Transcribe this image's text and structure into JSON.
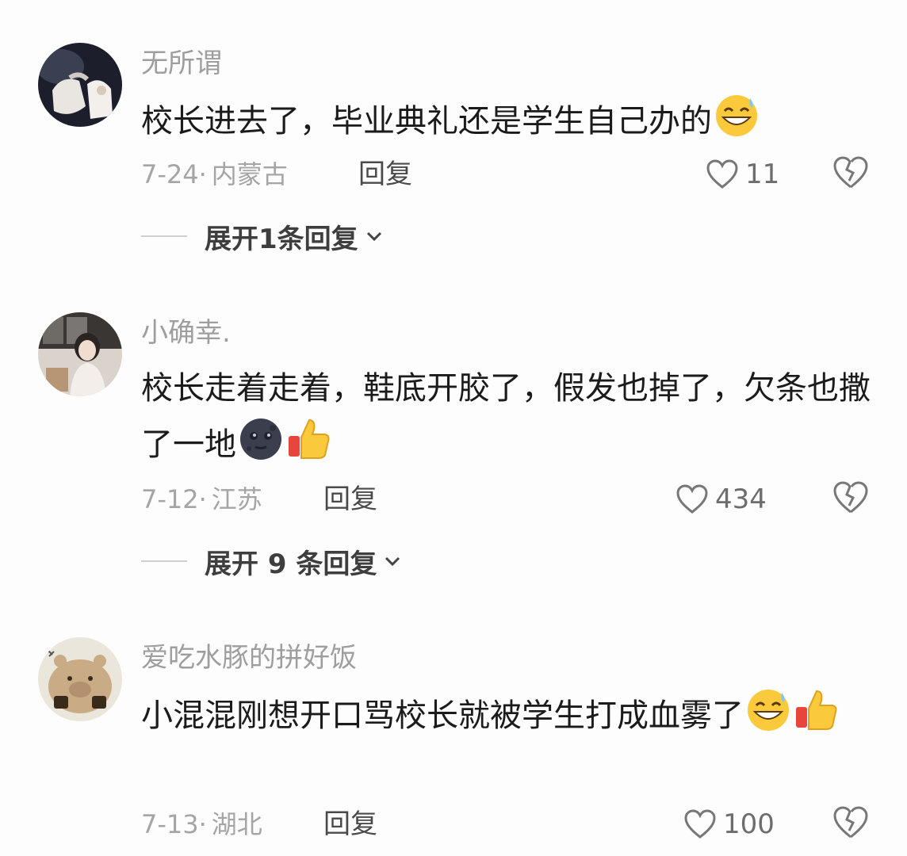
{
  "comments": [
    {
      "username": "无所谓",
      "content": "校长进去了，毕业典礼还是学生自己办的",
      "date": "7-24·",
      "location": "内蒙古",
      "reply_label": "回复",
      "likes": "11",
      "expand_text": "展开1条回复",
      "emoji": [
        "grinning-sweat-emoji"
      ]
    },
    {
      "username": "小确幸.",
      "content": "校长走着走着，鞋底开胶了，假发也掉了，欠条也撒了一地",
      "date": "7-12·",
      "location": "江苏",
      "reply_label": "回复",
      "likes": "434",
      "expand_text": "展开 9 条回复",
      "emoji": [
        "dark-moon-face-emoji",
        "thumbs-up-emoji"
      ]
    },
    {
      "username": "爱吃水豚的拼好饭",
      "content": "小混混刚想开口骂校长就被学生打成血雾了",
      "date": "7-13·",
      "location": "湖北",
      "reply_label": "回复",
      "likes": "100",
      "emoji": [
        "grinning-sweat-emoji",
        "thumbs-up-emoji"
      ]
    }
  ],
  "icons": {
    "like": "heart-outline-icon",
    "dislike": "broken-heart-outline-icon",
    "expand": "chevron-down-icon"
  },
  "colors": {
    "background": "#fdfdfd",
    "username": "#9e9e9e",
    "content": "#1b1b1b",
    "meta": "#a5a5a5"
  }
}
